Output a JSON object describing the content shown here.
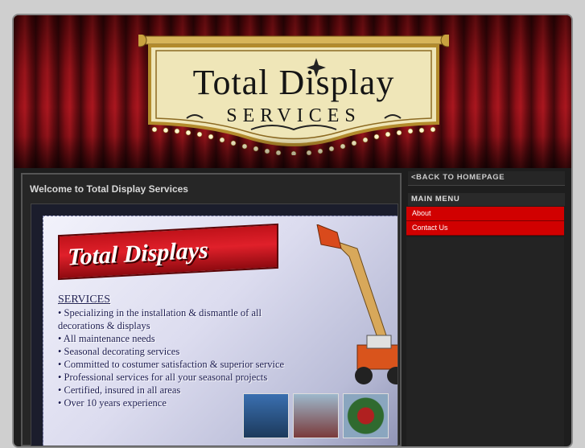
{
  "header": {
    "logo_line1": "Total Display",
    "logo_line2": "SERVICES"
  },
  "main": {
    "welcome_title": "Welcome to Total Display Services",
    "poster": {
      "banner_text": "Total Displays",
      "services_heading": "SERVICES",
      "services": [
        "• Specializing in the installation & dismantle of all decorations & displays",
        "• All maintenance needs",
        "• Seasonal decorating services",
        "• Committed to costumer satisfaction & superior service",
        "• Professional services for all your seasonal projects",
        "• Certified, insured in all areas",
        "• Over 10 years experience"
      ]
    }
  },
  "sidebar": {
    "back_link": "<BACK TO HOMEPAGE",
    "menu_title": "MAIN MENU",
    "menu_items": [
      "About",
      "Contact Us"
    ]
  },
  "colors": {
    "curtain_red": "#a3121b",
    "menu_red": "#d10000",
    "sign_cream": "#efe6b8"
  }
}
